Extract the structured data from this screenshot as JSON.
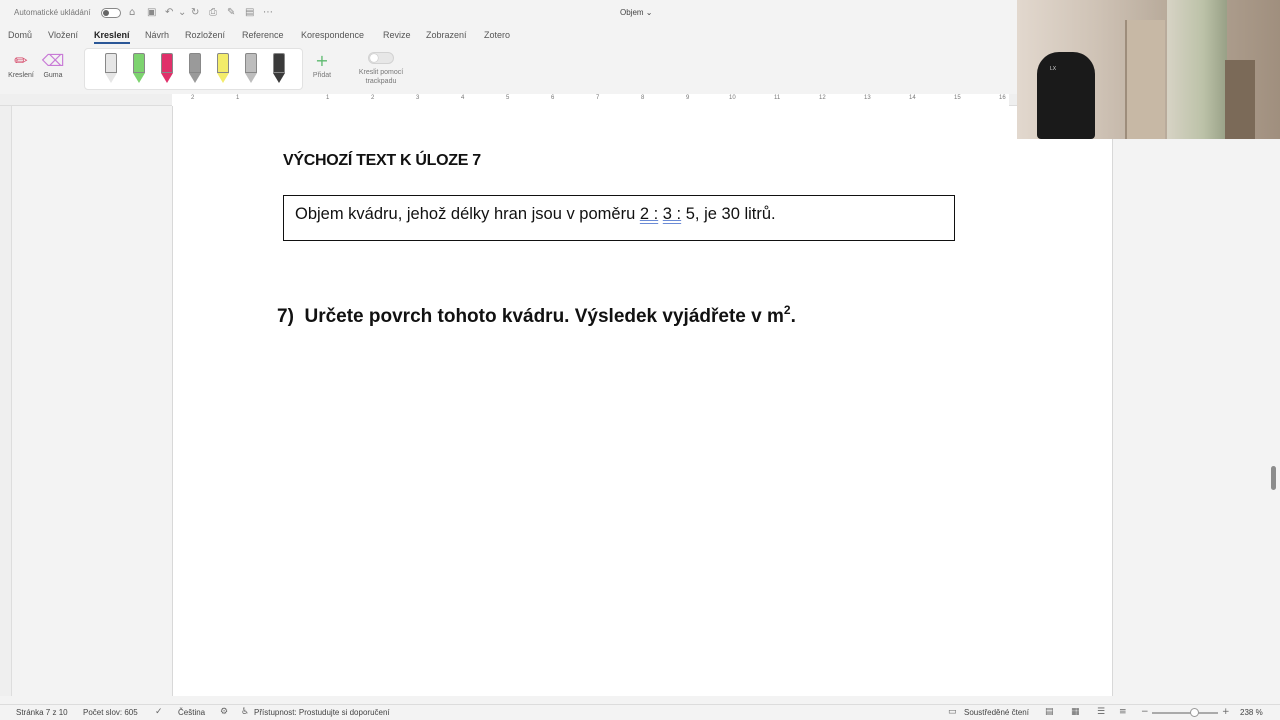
{
  "titlebar": {
    "autosave_label": "Automatické ukládání",
    "document_title": "Objem",
    "quick_icons": [
      "home-icon",
      "save-icon",
      "undo-icon",
      "redo-icon",
      "print-icon",
      "pen-icon",
      "layout-icon",
      "more-icon"
    ]
  },
  "tabs": [
    "Domů",
    "Vložení",
    "Kreslení",
    "Návrh",
    "Rozložení",
    "Reference",
    "Korespondence",
    "Revize",
    "Zobrazení",
    "Zotero"
  ],
  "active_tab": "Kreslení",
  "ribbon": {
    "draw_label": "Kreslení",
    "eraser_label": "Guma",
    "add_label": "Přidat",
    "trackpad_label": "Kreslit pomocí trackpadu",
    "pens": [
      {
        "color": "#e6e6e6"
      },
      {
        "color": "#7dd36f"
      },
      {
        "color": "#e0306a"
      },
      {
        "color": "#9a9a9a"
      },
      {
        "color": "#f3ec6a"
      },
      {
        "color": "#bdbdbd"
      },
      {
        "color": "#3a3a3a"
      }
    ]
  },
  "ruler": {
    "numbers": [
      "2",
      "1",
      "1",
      "2",
      "3",
      "4",
      "5",
      "6",
      "7",
      "8",
      "9",
      "10",
      "11",
      "12",
      "13",
      "14",
      "15",
      "16"
    ]
  },
  "document": {
    "heading": "VÝCHOZÍ TEXT K ÚLOZE 7",
    "box_text_before": "Objem kvádru, jehož délky hran jsou v poměru ",
    "box_ratio_a": "2 :",
    "box_ratio_b": "3 :",
    "box_text_after": " 5, je 30 litrů.",
    "question_number": "7)",
    "question_text": "Určete povrch tohoto kvádru. Výsledek vyjádřete v m",
    "question_sup": "2",
    "question_end": "."
  },
  "statusbar": {
    "page": "Stránka 7 z 10",
    "words": "Počet slov: 605",
    "language": "Čeština",
    "accessibility": "Přístupnost: Prostudujte si doporučení",
    "focus": "Soustředěné čtení",
    "zoom": "238 %"
  },
  "webcam": {
    "chair_logo": "LX"
  }
}
